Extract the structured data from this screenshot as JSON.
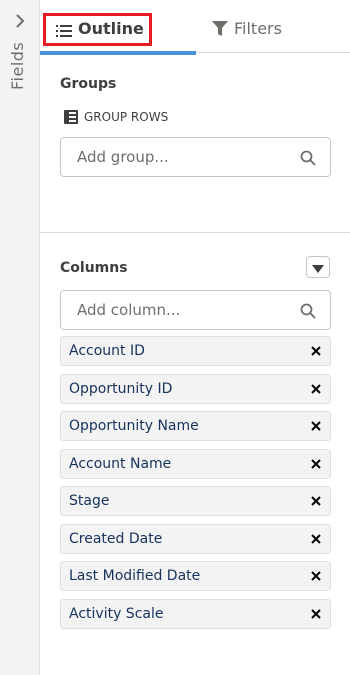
{
  "rail": {
    "label": "Fields"
  },
  "tabs": {
    "outline_label": "Outline",
    "filters_label": "Filters",
    "active": "Outline"
  },
  "groups": {
    "title": "Groups",
    "group_rows_label": "GROUP ROWS",
    "placeholder": "Add group..."
  },
  "columns": {
    "title": "Columns",
    "placeholder": "Add column...",
    "items": [
      {
        "label": "Account ID"
      },
      {
        "label": "Opportunity ID"
      },
      {
        "label": "Opportunity Name"
      },
      {
        "label": "Account Name"
      },
      {
        "label": "Stage"
      },
      {
        "label": "Created Date"
      },
      {
        "label": "Last Modified Date"
      },
      {
        "label": "Activity Scale"
      }
    ]
  },
  "colors": {
    "highlight": "#e51c23",
    "tab_underline": "#4a90d9",
    "column_text": "#16325c"
  },
  "icons": {
    "rail": "chevron-right-icon",
    "outline": "list-icon",
    "filters": "filter-funnel-icon",
    "group_rows": "table-rows-icon",
    "search": "search-icon",
    "dropdown": "caret-down-icon",
    "remove": "close-icon"
  }
}
